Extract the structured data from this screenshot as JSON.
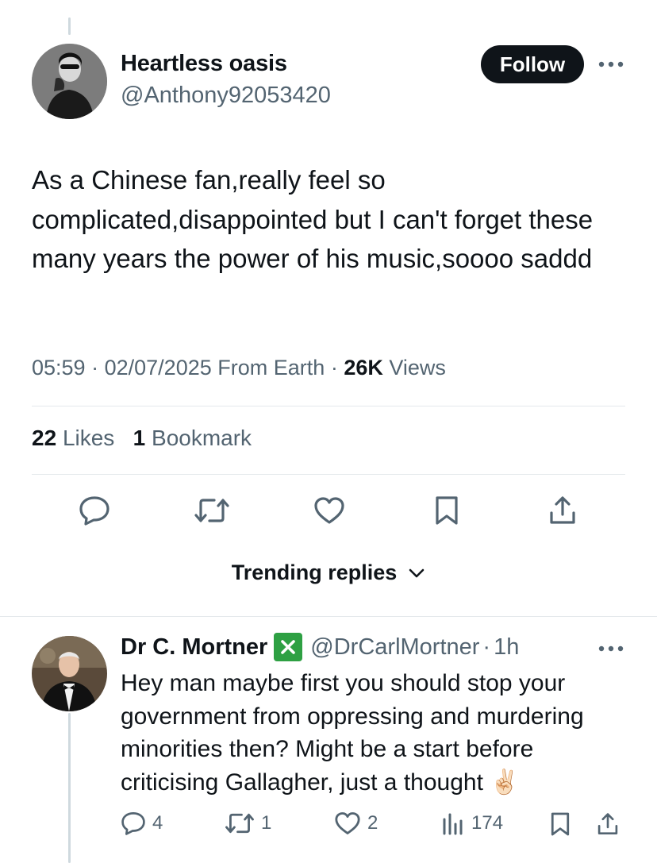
{
  "tweet": {
    "author_name": "Heartless oasis",
    "author_handle": "@Anthony92053420",
    "follow_label": "Follow",
    "text": "As a Chinese fan,really feel so complicated,disappointed but I can't forget these many years the power of his music,soooo saddd",
    "time": "05:59",
    "separator": "·",
    "date": "02/07/2025",
    "source": "From Earth",
    "views_count": "26K",
    "views_label": "Views",
    "likes_count": "22",
    "likes_label": "Likes",
    "bookmarks_count": "1",
    "bookmarks_label": "Bookmark"
  },
  "actions": {
    "icons": [
      "reply-icon",
      "retweet-icon",
      "like-icon",
      "bookmark-icon",
      "share-icon"
    ]
  },
  "trending": {
    "label": "Trending replies",
    "icon": "chevron-down-icon"
  },
  "reply": {
    "author_name": "Dr C. Mortner",
    "author_handle": "@DrCarlMortner",
    "separator": "·",
    "time": "1h",
    "text": "Hey man maybe first you should stop your government from oppressing and murdering minorities then? Might be a start before criticising Gallagher, just a thought",
    "emoji": "✌🏻",
    "reply_count": "4",
    "retweet_count": "1",
    "like_count": "2",
    "views_count": "174"
  },
  "colors": {
    "text_primary": "#0f1419",
    "text_secondary": "#536471",
    "divider": "#e5e9ec",
    "verified_badge": "#2ea043"
  }
}
